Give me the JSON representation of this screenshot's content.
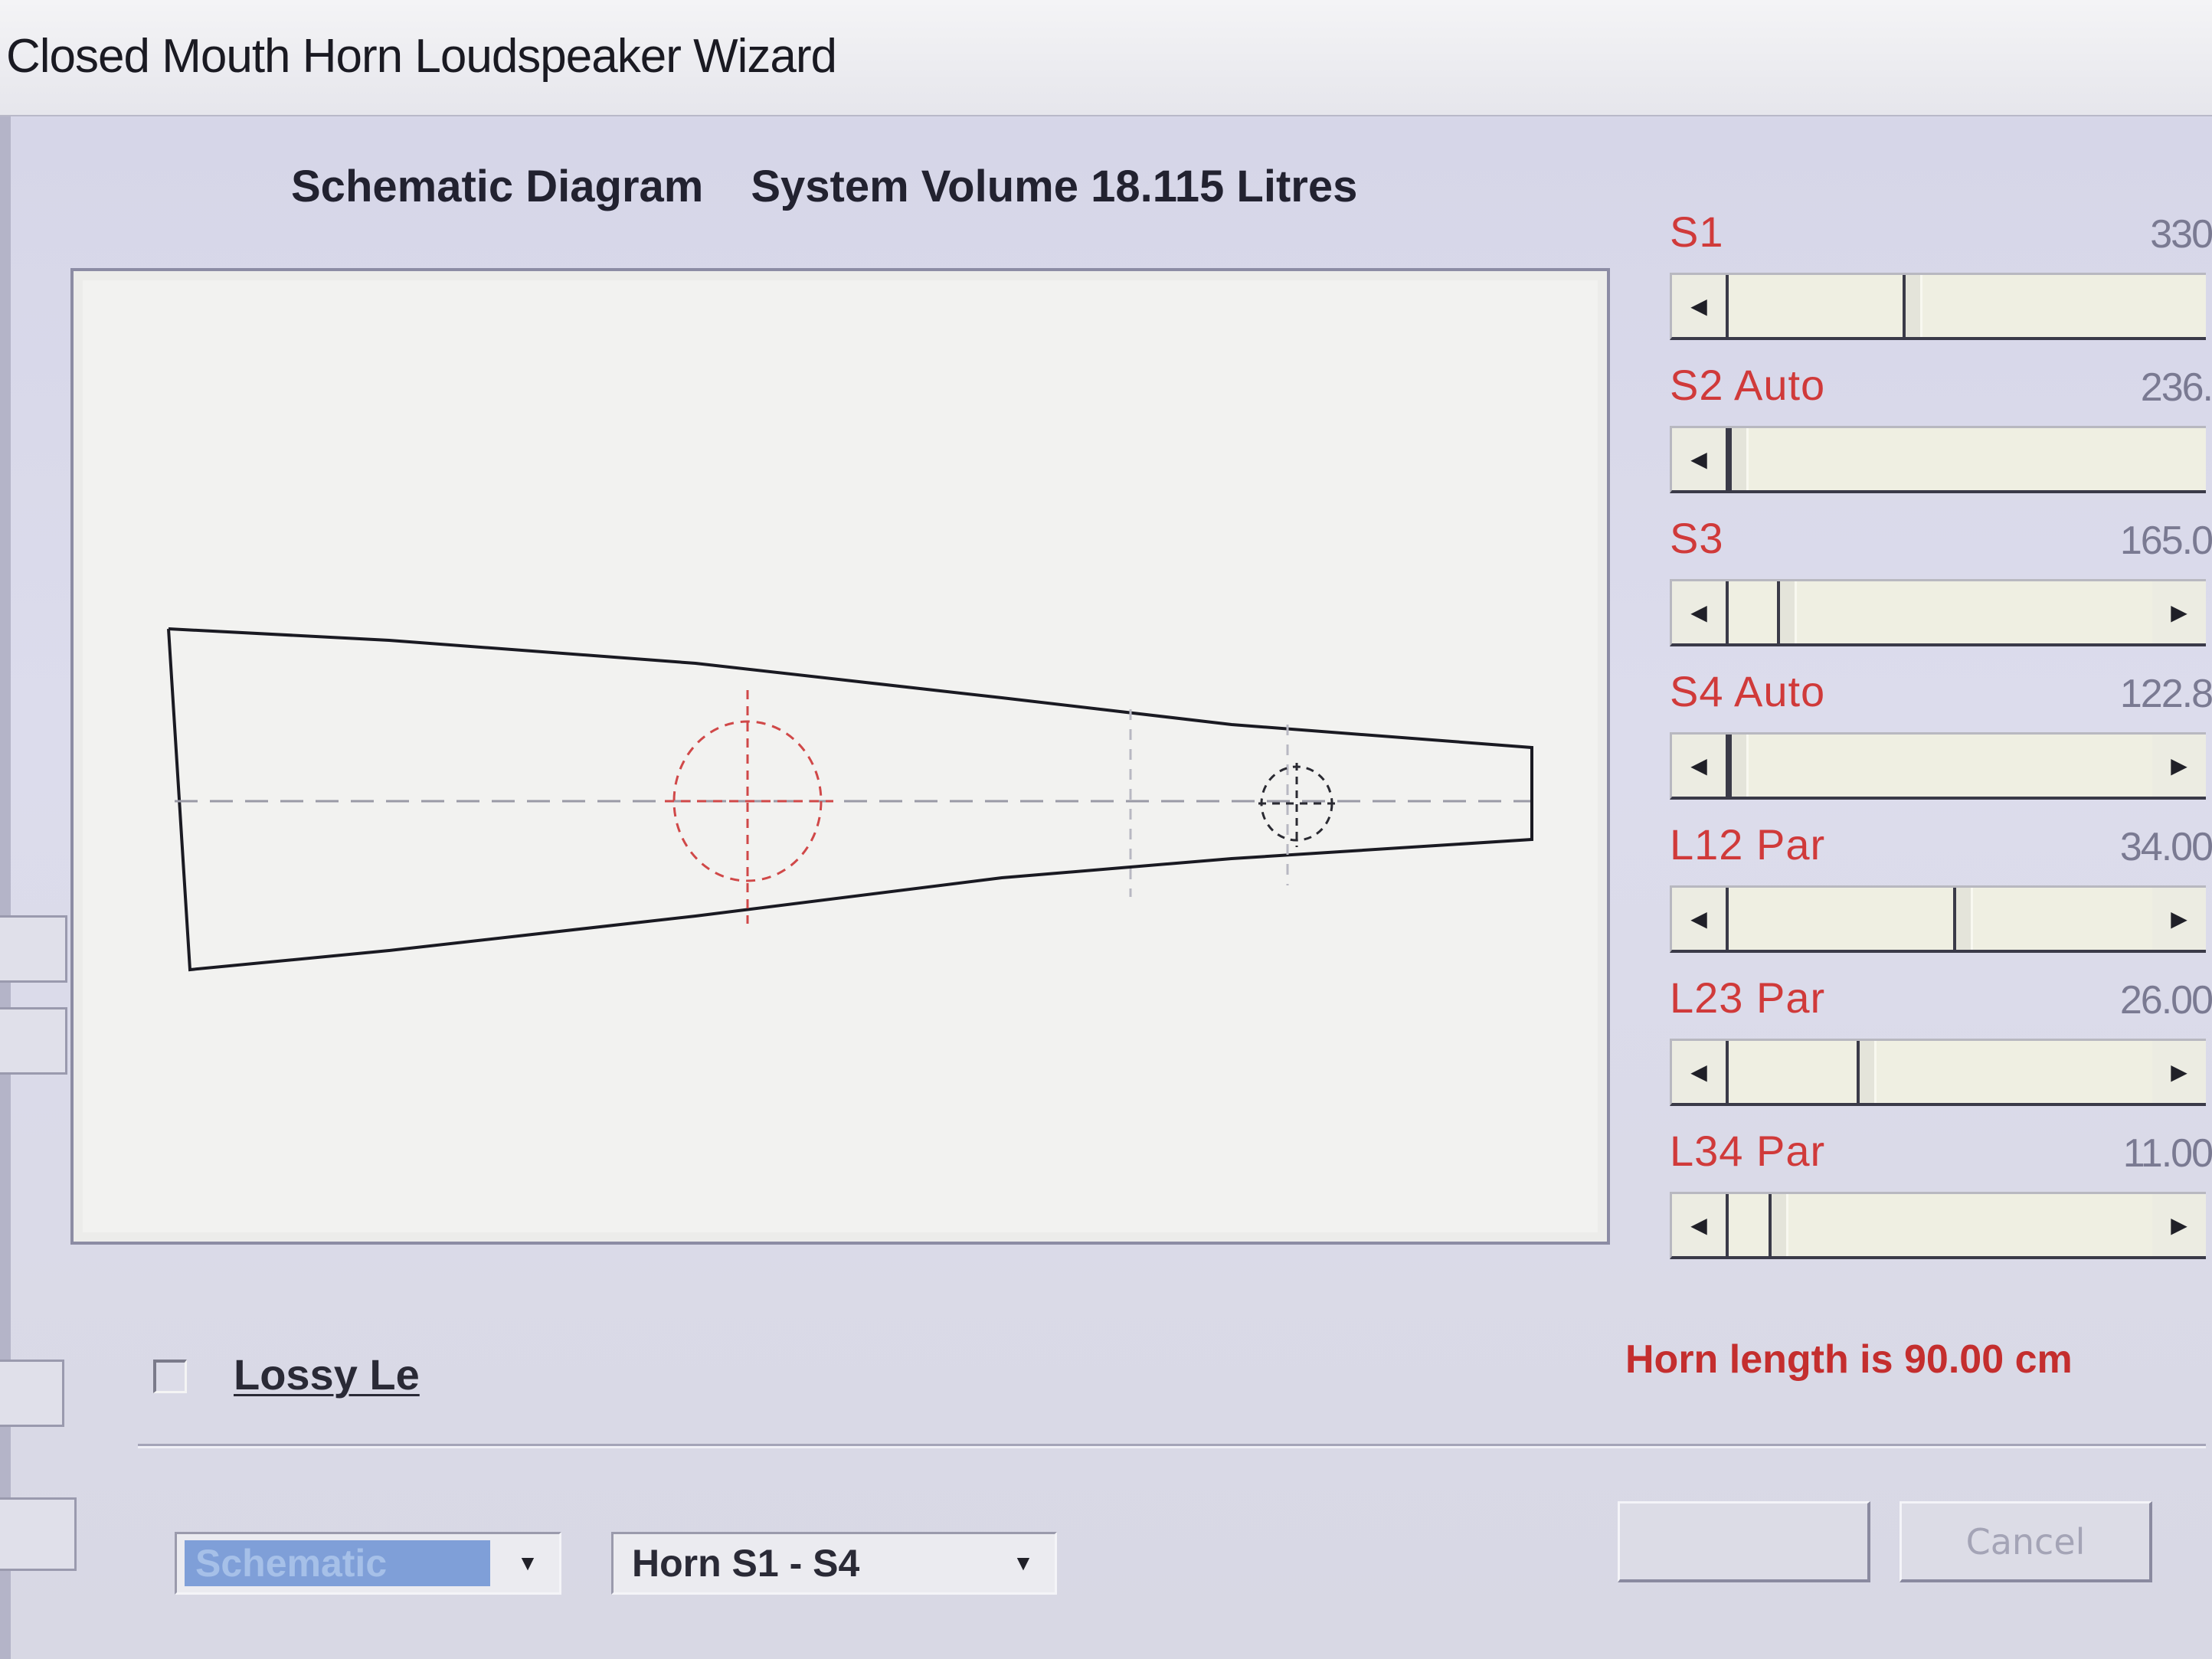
{
  "window": {
    "title": "Closed Mouth Horn Loudspeaker Wizard"
  },
  "diagram": {
    "heading": "Schematic Diagram",
    "volume_label": "System Volume 18.115 Litres"
  },
  "sliders": [
    {
      "label": "S1",
      "value": "330",
      "thumb_fraction": 0.38,
      "has_right_arrow": false
    },
    {
      "label": "S2 Auto",
      "value": "236.",
      "thumb_fraction": 0.0,
      "has_right_arrow": false
    },
    {
      "label": "S3",
      "value": "165.0",
      "thumb_fraction": 0.12,
      "has_right_arrow": true
    },
    {
      "label": "S4 Auto",
      "value": "122.8",
      "thumb_fraction": 0.0,
      "has_right_arrow": true
    },
    {
      "label": "L12 Par",
      "value": "34.00",
      "thumb_fraction": 0.56,
      "has_right_arrow": true
    },
    {
      "label": "L23 Par",
      "value": "26.00",
      "thumb_fraction": 0.32,
      "has_right_arrow": true
    },
    {
      "label": "L34 Par",
      "value": "11.00",
      "thumb_fraction": 0.1,
      "has_right_arrow": true
    }
  ],
  "options": {
    "lossy_label": "Lossy Le",
    "lossy_checked": false
  },
  "status": {
    "horn_length": "Horn length is 90.00 cm"
  },
  "bottom": {
    "view_select": "Schematic",
    "horn_select": "Horn S1 - S4",
    "cancel_label": "Cancel",
    "ok_label": ""
  },
  "colors": {
    "label_red": "#d03a3a",
    "driver_red": "#d04848",
    "outline": "#1a1a22",
    "select_highlight": "#7f9fd8"
  },
  "icons": {
    "scroll_left": "triangle-left-icon",
    "scroll_right": "triangle-right-icon",
    "combo_dropdown": "triangle-down-icon"
  }
}
